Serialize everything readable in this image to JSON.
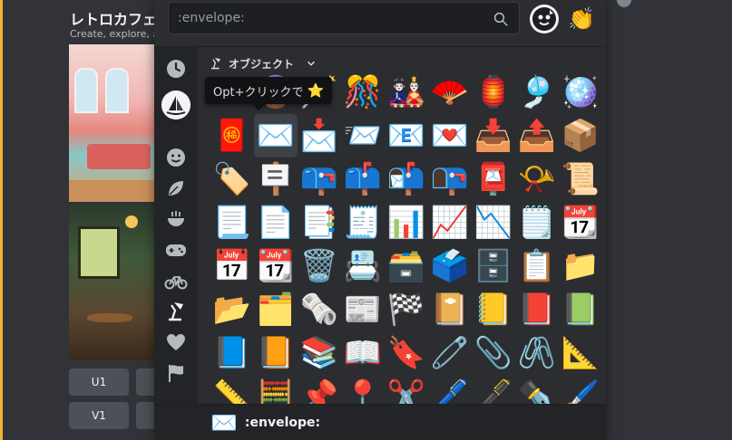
{
  "background": {
    "title": "レトロカフェ",
    "subtitle": "Create, explore, a",
    "buttons": [
      {
        "label": "U1"
      },
      {
        "label": "V1"
      }
    ]
  },
  "search": {
    "placeholder": ":envelope:",
    "value": ""
  },
  "category_header": {
    "label": "オブジェクト",
    "icon": "lamp-icon",
    "chevron": "chevron-down-icon"
  },
  "tooltip": {
    "text": "Opt+クリックで",
    "emoji": "⭐"
  },
  "categories": [
    {
      "name": "recent",
      "icon": "🕘"
    },
    {
      "name": "server",
      "icon": "⛵"
    },
    {
      "name": "people",
      "icon": "🙂"
    },
    {
      "name": "nature",
      "icon": "🍃"
    },
    {
      "name": "food",
      "icon": "🍜"
    },
    {
      "name": "activities",
      "icon": "🎮"
    },
    {
      "name": "travel",
      "icon": "🚲"
    },
    {
      "name": "objects",
      "icon": "💡"
    },
    {
      "name": "symbols",
      "icon": "❤"
    },
    {
      "name": "flags",
      "icon": "🏳"
    }
  ],
  "emoji_rows": [
    [
      "🔮",
      "🪄",
      "🎊",
      "🎎",
      "🪭",
      "🏮",
      "🎐",
      "🪩"
    ],
    [
      "🧧",
      "✉️",
      "📩",
      "📨",
      "📧",
      "💌",
      "📥",
      "📤",
      "📦"
    ],
    [
      "🏷️",
      "🪧",
      "📪",
      "📫",
      "📬",
      "📭",
      "📮",
      "📯",
      "📜"
    ],
    [
      "📃",
      "📄",
      "📑",
      "🧾",
      "📊",
      "📈",
      "📉",
      "🗒️",
      "📆"
    ],
    [
      "📅",
      "📆",
      "🗑️",
      "📇",
      "🗃️",
      "🗳️",
      "🗄️",
      "📋",
      "📁"
    ],
    [
      "📂",
      "🗂️",
      "🗞️",
      "📰",
      "🏁",
      "📔",
      "📒",
      "📕",
      "📗"
    ],
    [
      "📘",
      "📙",
      "📚",
      "📖",
      "🔖",
      "🧷",
      "📎",
      "🖇️",
      "📐"
    ],
    [
      "📏",
      "🧮",
      "📌",
      "📍",
      "✂️",
      "🖊️",
      "🖋️",
      "✒️",
      "🖌️"
    ]
  ],
  "selected_emoji": {
    "row": 1,
    "col": 1
  },
  "footer": {
    "emoji": "✉️",
    "name": ":envelope:"
  },
  "tone_emoji": "👏",
  "colors": {
    "accent": "#f0b232",
    "picker_bg": "#2b2d31",
    "selected_bg": "#3f4147"
  }
}
